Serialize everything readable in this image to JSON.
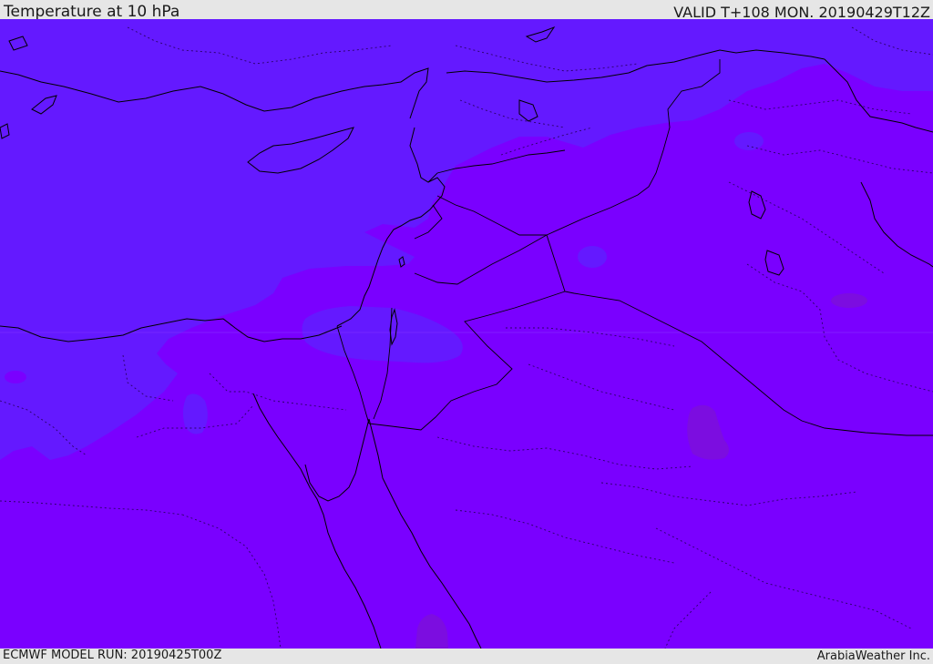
{
  "header": {
    "title": "Temperature at 10 hPa",
    "valid": "VALID T+108 MON. 20190429T12Z"
  },
  "footer": {
    "model_run": "ECMWF MODEL RUN: 20190425T00Z",
    "credit": "ArabiaWeather Inc."
  },
  "map": {
    "region": "Eastern Mediterranean and Middle East",
    "field": "temperature",
    "level": "10 hPa",
    "colors": {
      "cold_shade": "#6419ff",
      "warm_shade": "#7a00ff",
      "warmest_patch": "#7c0de0",
      "coastline": "#000000",
      "borders": "#2a0066"
    }
  }
}
